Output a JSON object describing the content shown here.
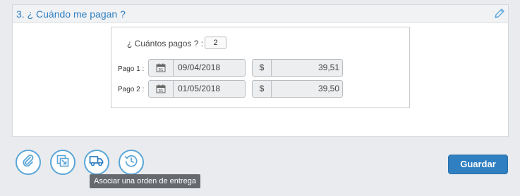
{
  "section": {
    "title": "3. ¿ Cuándo me pagan ?",
    "edit_icon": "pencil-icon"
  },
  "payments": {
    "count_label": "¿ Cuántos pagos ? :",
    "count_value": "2",
    "rows": [
      {
        "label": "Pago 1 :",
        "date": "09/04/2018",
        "currency": "$",
        "amount": "39,51"
      },
      {
        "label": "Pago 2 :",
        "date": "01/05/2018",
        "currency": "$",
        "amount": "39,50"
      }
    ]
  },
  "toolbar": {
    "buttons": [
      {
        "icon": "paperclip-icon"
      },
      {
        "icon": "link-document-icon"
      },
      {
        "icon": "truck-icon"
      },
      {
        "icon": "history-icon"
      }
    ],
    "tooltip": "Asociar una orden de entrega",
    "save_label": "Guardar"
  },
  "colors": {
    "accent": "#2f7fc1",
    "icon_blue": "#5aa6d8",
    "background": "#e9ebee"
  }
}
